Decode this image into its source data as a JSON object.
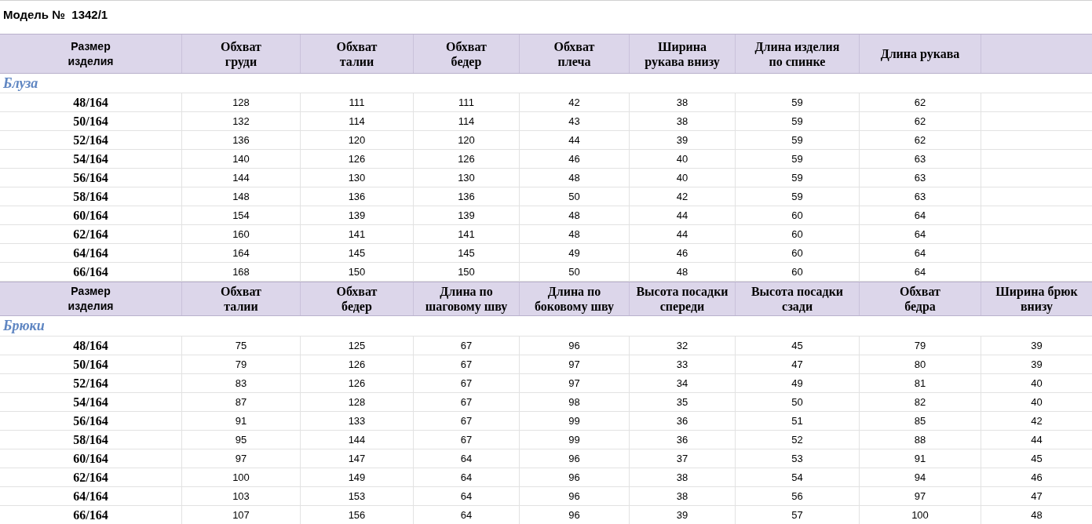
{
  "title": "Модель №  1342/1",
  "sections": [
    {
      "headers": [
        "Размер\nизделия",
        "Обхват\nгруди",
        "Обхват\nталии",
        "Обхват\nбедер",
        "Обхват\nплеча",
        "Ширина\nрукава внизу",
        "Длина изделия\nпо спинке",
        "Длина рукава"
      ],
      "label": "Блуза",
      "rows": [
        {
          "size": "48/164",
          "values": [
            "128",
            "111",
            "111",
            "42",
            "38",
            "59",
            "62"
          ]
        },
        {
          "size": "50/164",
          "values": [
            "132",
            "114",
            "114",
            "43",
            "38",
            "59",
            "62"
          ]
        },
        {
          "size": "52/164",
          "values": [
            "136",
            "120",
            "120",
            "44",
            "39",
            "59",
            "62"
          ]
        },
        {
          "size": "54/164",
          "values": [
            "140",
            "126",
            "126",
            "46",
            "40",
            "59",
            "63"
          ]
        },
        {
          "size": "56/164",
          "values": [
            "144",
            "130",
            "130",
            "48",
            "40",
            "59",
            "63"
          ]
        },
        {
          "size": "58/164",
          "values": [
            "148",
            "136",
            "136",
            "50",
            "42",
            "59",
            "63"
          ]
        },
        {
          "size": "60/164",
          "values": [
            "154",
            "139",
            "139",
            "48",
            "44",
            "60",
            "64"
          ]
        },
        {
          "size": "62/164",
          "values": [
            "160",
            "141",
            "141",
            "48",
            "44",
            "60",
            "64"
          ]
        },
        {
          "size": "64/164",
          "values": [
            "164",
            "145",
            "145",
            "49",
            "46",
            "60",
            "64"
          ]
        },
        {
          "size": "66/164",
          "values": [
            "168",
            "150",
            "150",
            "50",
            "48",
            "60",
            "64"
          ]
        }
      ]
    },
    {
      "headers": [
        "Размер\nизделия",
        "Обхват\nталии",
        "Обхват\nбедер",
        "Длина по\nшаговому шву",
        "Длина по\nбоковому шву",
        "Высота посадки\nспереди",
        "Высота посадки\nсзади",
        "Обхват\nбедра",
        "Ширина брюк\nвнизу"
      ],
      "label": "Брюки",
      "rows": [
        {
          "size": "48/164",
          "values": [
            "75",
            "125",
            "67",
            "96",
            "32",
            "45",
            "79",
            "39"
          ]
        },
        {
          "size": "50/164",
          "values": [
            "79",
            "126",
            "67",
            "97",
            "33",
            "47",
            "80",
            "39"
          ]
        },
        {
          "size": "52/164",
          "values": [
            "83",
            "126",
            "67",
            "97",
            "34",
            "49",
            "81",
            "40"
          ]
        },
        {
          "size": "54/164",
          "values": [
            "87",
            "128",
            "67",
            "98",
            "35",
            "50",
            "82",
            "40"
          ]
        },
        {
          "size": "56/164",
          "values": [
            "91",
            "133",
            "67",
            "99",
            "36",
            "51",
            "85",
            "42"
          ]
        },
        {
          "size": "58/164",
          "values": [
            "95",
            "144",
            "67",
            "99",
            "36",
            "52",
            "88",
            "44"
          ]
        },
        {
          "size": "60/164",
          "values": [
            "97",
            "147",
            "64",
            "96",
            "37",
            "53",
            "91",
            "45"
          ]
        },
        {
          "size": "62/164",
          "values": [
            "100",
            "149",
            "64",
            "96",
            "38",
            "54",
            "94",
            "46"
          ]
        },
        {
          "size": "64/164",
          "values": [
            "103",
            "153",
            "64",
            "96",
            "38",
            "56",
            "97",
            "47"
          ]
        },
        {
          "size": "66/164",
          "values": [
            "107",
            "156",
            "64",
            "96",
            "39",
            "57",
            "100",
            "48"
          ]
        }
      ]
    }
  ]
}
